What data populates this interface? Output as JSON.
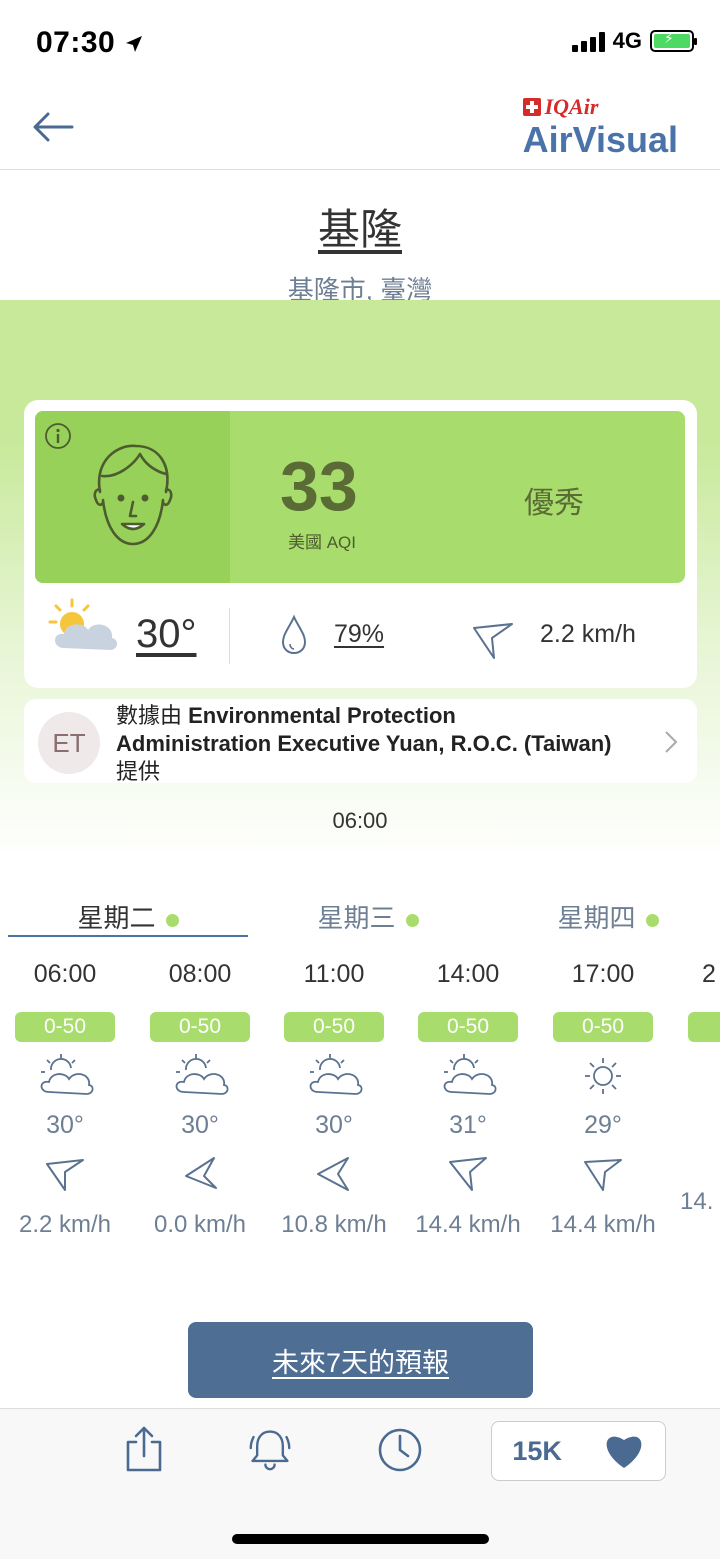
{
  "status": {
    "time": "07:30",
    "network": "4G"
  },
  "header": {
    "logo_brand": "IQAir",
    "logo_product": "AirVisual"
  },
  "location": {
    "city": "基隆",
    "region": "基隆市, 臺灣"
  },
  "aqi": {
    "value": "33",
    "label": "美國 AQI",
    "level": "優秀",
    "color": "#a8dd6d"
  },
  "weather": {
    "temp": "30°",
    "humidity": "79%",
    "wind": "2.2 km/h"
  },
  "source": {
    "initials": "ET",
    "prefix": "數據由 ",
    "name": "Environmental Protection Administration Executive Yuan, R.O.C. (Taiwan)",
    "suffix": " 提供"
  },
  "update_time": "06:00",
  "days": [
    {
      "label": "星期二"
    },
    {
      "label": "星期三"
    },
    {
      "label": "星期四"
    }
  ],
  "hourly": [
    {
      "time": "06:00",
      "aqi": "0-50",
      "icon": "partly-cloudy-icon",
      "temp": "30°",
      "wind": "2.2 km/h"
    },
    {
      "time": "08:00",
      "aqi": "0-50",
      "icon": "partly-cloudy-icon",
      "temp": "30°",
      "wind": "0.0 km/h"
    },
    {
      "time": "11:00",
      "aqi": "0-50",
      "icon": "partly-cloudy-icon",
      "temp": "30°",
      "wind": "10.8 km/h"
    },
    {
      "time": "14:00",
      "aqi": "0-50",
      "icon": "partly-cloudy-icon",
      "temp": "31°",
      "wind": "14.4 km/h"
    },
    {
      "time": "17:00",
      "aqi": "0-50",
      "icon": "sun-icon",
      "temp": "29°",
      "wind": "14.4 km/h"
    },
    {
      "time": "2",
      "aqi": "",
      "icon": "",
      "temp": "",
      "wind": "14."
    }
  ],
  "forecast_button": "未來7天的預報",
  "likes": "15K",
  "colors": {
    "accent": "#4a73a9",
    "aqi_good": "#a8dd6d",
    "button": "#4f6e94"
  }
}
